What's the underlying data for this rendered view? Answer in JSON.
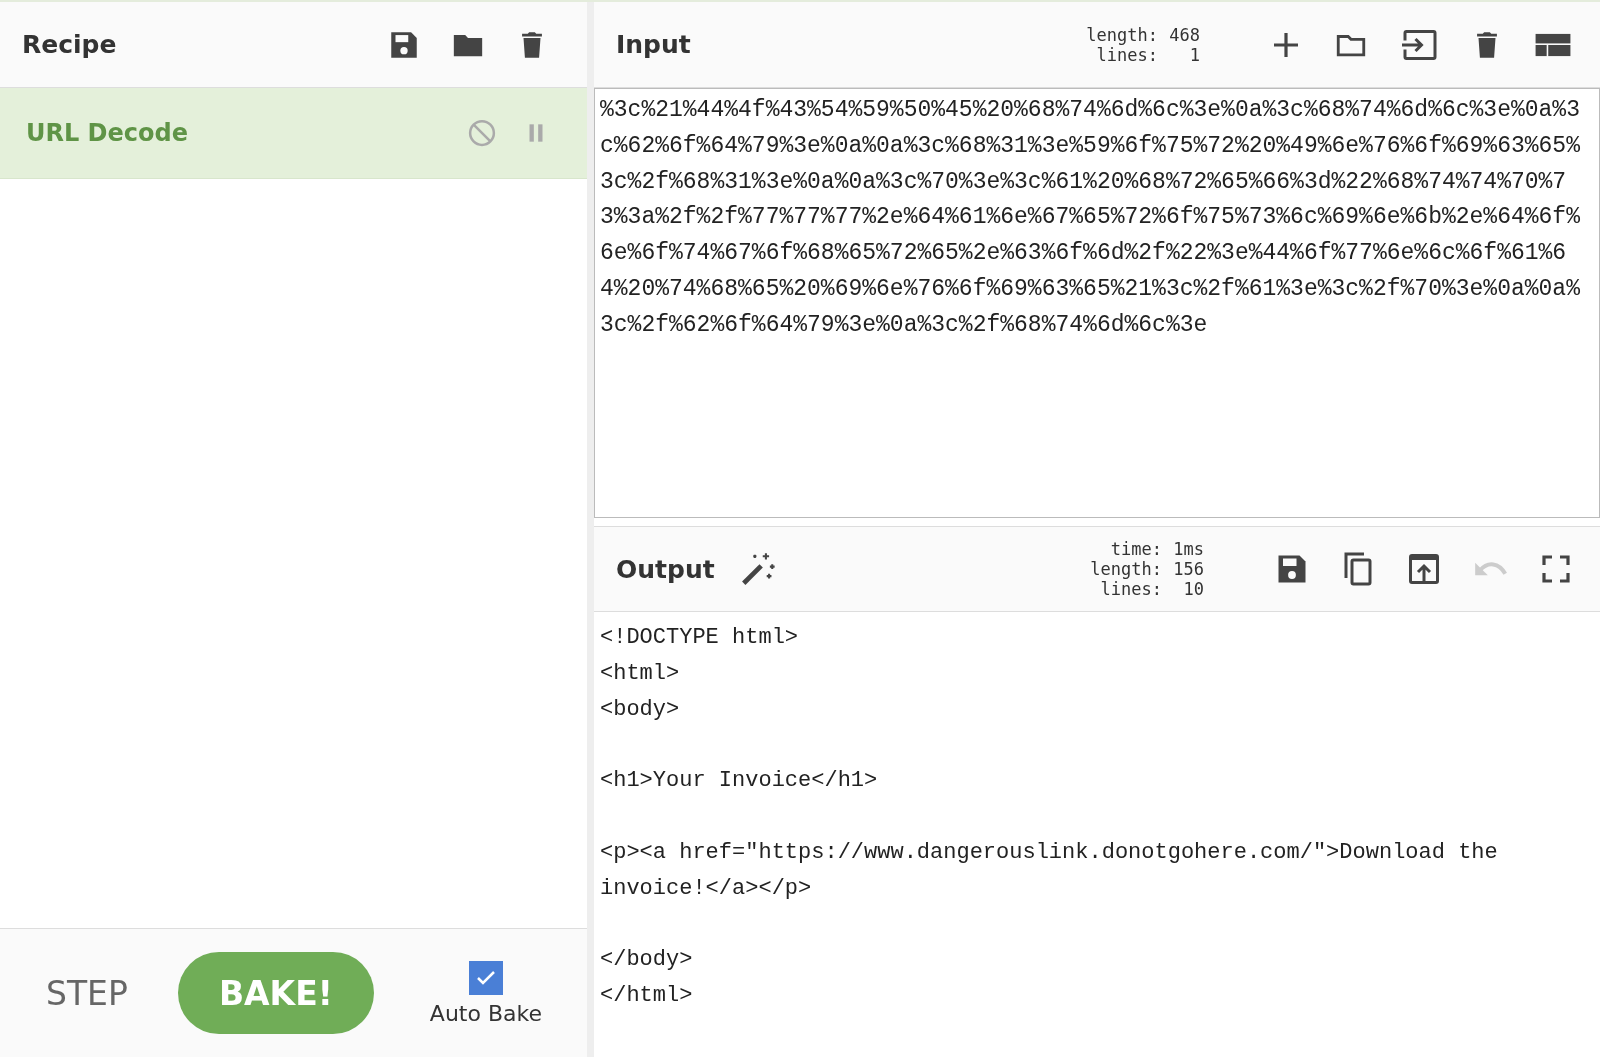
{
  "recipe": {
    "title": "Recipe",
    "operations": [
      {
        "name": "URL Decode"
      }
    ]
  },
  "controls": {
    "step": "STEP",
    "bake": "BAKE!",
    "auto_bake": {
      "label": "Auto Bake",
      "checked": true
    }
  },
  "input": {
    "title": "Input",
    "stats": [
      {
        "label": "length:",
        "value": "468"
      },
      {
        "label": "lines:",
        "value": "1"
      }
    ],
    "text": "%3c%21%44%4f%43%54%59%50%45%20%68%74%6d%6c%3e%0a%3c%68%74%6d%6c%3e%0a%3c%62%6f%64%79%3e%0a%0a%3c%68%31%3e%59%6f%75%72%20%49%6e%76%6f%69%63%65%3c%2f%68%31%3e%0a%0a%3c%70%3e%3c%61%20%68%72%65%66%3d%22%68%74%74%70%73%3a%2f%2f%77%77%77%2e%64%61%6e%67%65%72%6f%75%73%6c%69%6e%6b%2e%64%6f%6e%6f%74%67%6f%68%65%72%65%2e%63%6f%6d%2f%22%3e%44%6f%77%6e%6c%6f%61%64%20%74%68%65%20%69%6e%76%6f%69%63%65%21%3c%2f%61%3e%3c%2f%70%3e%0a%0a%3c%2f%62%6f%64%79%3e%0a%3c%2f%68%74%6d%6c%3e"
  },
  "output": {
    "title": "Output",
    "stats": [
      {
        "label": "time:",
        "value": "1ms"
      },
      {
        "label": "length:",
        "value": "156"
      },
      {
        "label": "lines:",
        "value": "10"
      }
    ],
    "undo_disabled": true,
    "text": "<!DOCTYPE html>\n<html>\n<body>\n\n<h1>Your Invoice</h1>\n\n<p><a href=\"https://www.dangerouslink.donotgohere.com/\">Download the invoice!</a></p>\n\n</body>\n</html>"
  }
}
